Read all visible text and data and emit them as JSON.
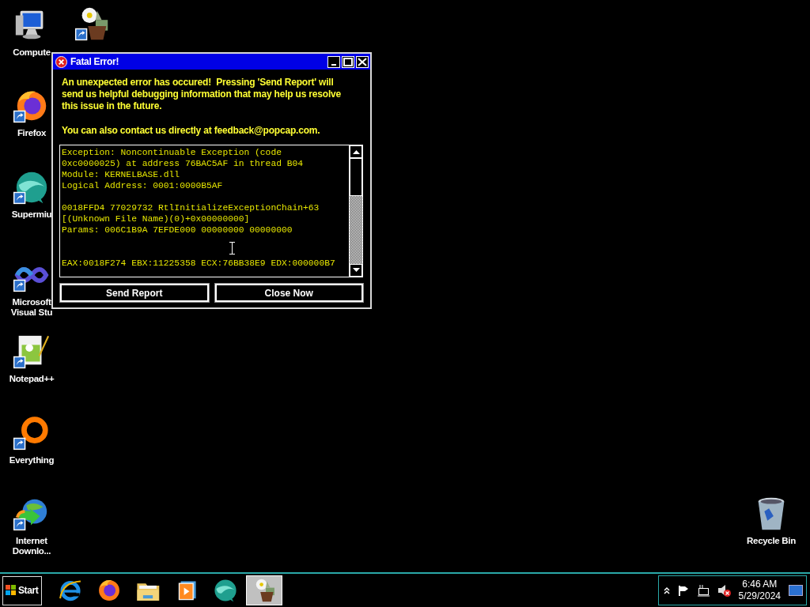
{
  "desktop_icons": [
    {
      "kind": "computer",
      "lines": [
        "Compute"
      ],
      "shortcut": false
    },
    {
      "kind": "plants",
      "shortcut": true
    },
    {
      "kind": "firefox",
      "lines": [
        "Firefox"
      ],
      "shortcut": true
    },
    {
      "kind": "supermium",
      "lines": [
        "Supermiu"
      ],
      "shortcut": true
    },
    {
      "kind": "vs",
      "lines": [
        "Microsoft",
        "Visual Stu"
      ],
      "shortcut": true
    },
    {
      "kind": "notepad",
      "lines": [
        "Notepad++"
      ],
      "shortcut": true
    },
    {
      "kind": "everything",
      "lines": [
        "Everything"
      ],
      "shortcut": true
    },
    {
      "kind": "idm",
      "lines": [
        "Internet",
        "Downlo..."
      ],
      "shortcut": true
    },
    {
      "kind": "recycle",
      "lines": [
        "Recycle Bin"
      ],
      "shortcut": false
    }
  ],
  "dialog": {
    "title": "Fatal Error!",
    "message": [
      "An unexpected error has occured!  Pressing 'Send Report' will send us helpful debugging information that may help us resolve this issue in the future.",
      "You can also contact us directly at feedback@popcap.com."
    ],
    "log": [
      [
        "Exception: Noncontinuable Exception (code",
        "0xc0000025) at address 76BAC5AF in thread B04",
        "Module: KERNELBASE.dll",
        "Logical Address: 0001:0000B5AF"
      ],
      [
        "0018FFD4 77029732 RtlInitializeExceptionChain+63",
        "[(Unknown File Name)(0)+0x00000000]",
        "Params: 006C1B9A 7EFDE000 00000000 00000000"
      ],
      [
        "EAX:0018F274 EBX:11225358 ECX:76BB38E9 EDX:000000B7"
      ]
    ],
    "buttons": [
      "Send Report",
      "Close Now"
    ]
  },
  "taskbar": {
    "start": "Start",
    "items": [
      {
        "kind": "ie",
        "selected": false
      },
      {
        "kind": "firefox",
        "selected": false
      },
      {
        "kind": "explorer",
        "selected": false
      },
      {
        "kind": "media",
        "selected": false
      },
      {
        "kind": "supermium",
        "selected": false
      },
      {
        "kind": "plants",
        "selected": true
      }
    ],
    "tray": {
      "volume_muted": true,
      "time": "6:46 AM",
      "date": "5/29/2024"
    }
  }
}
